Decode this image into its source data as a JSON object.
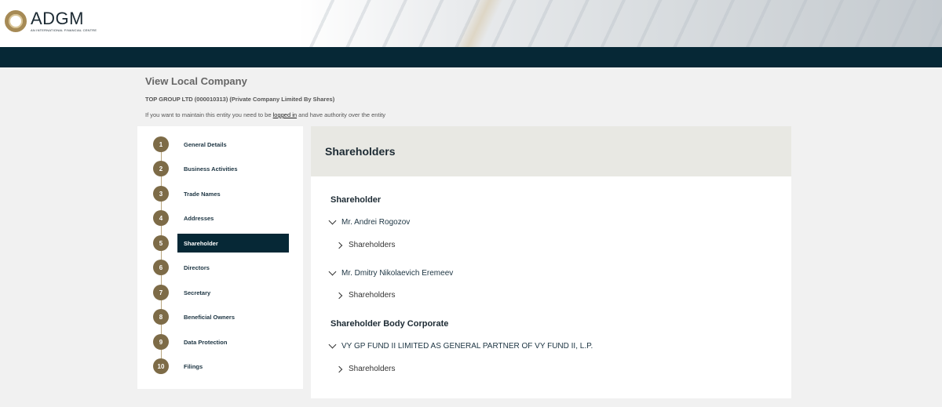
{
  "brand": {
    "name": "ADGM",
    "tagline": "AN INTERNATIONAL FINANCIAL CENTRE"
  },
  "page": {
    "title": "View Local Company",
    "entity": "TOP GROUP LTD (000010313) (Private Company Limited By Shares)",
    "notice_prefix": "If you want to maintain this entity you need to be",
    "notice_link": "logged in",
    "notice_suffix": "and have authority over the entity"
  },
  "steps": [
    {
      "num": "1",
      "label": "General Details"
    },
    {
      "num": "2",
      "label": "Business Activities"
    },
    {
      "num": "3",
      "label": "Trade Names"
    },
    {
      "num": "4",
      "label": "Addresses"
    },
    {
      "num": "5",
      "label": "Shareholder"
    },
    {
      "num": "6",
      "label": "Directors"
    },
    {
      "num": "7",
      "label": "Secretary"
    },
    {
      "num": "8",
      "label": "Beneficial Owners"
    },
    {
      "num": "9",
      "label": "Data Protection"
    },
    {
      "num": "10",
      "label": "Filings"
    }
  ],
  "active_step": 5,
  "main": {
    "title": "Shareholders",
    "sections": [
      {
        "title": "Shareholder",
        "entries": [
          {
            "name": "Mr. Andrei Rogozov",
            "sub": "Shareholders"
          },
          {
            "name": "Mr. Dmitry Nikolaevich Eremeev",
            "sub": "Shareholders"
          }
        ]
      },
      {
        "title": "Shareholder Body Corporate",
        "entries": [
          {
            "name": "VY GP FUND II LIMITED AS GENERAL PARTNER OF VY FUND II, L.P.",
            "sub": "Shareholders"
          }
        ]
      }
    ]
  },
  "colors": {
    "navy": "#062836",
    "gold": "#7d6b47",
    "panel_header": "#e8e8e3"
  }
}
